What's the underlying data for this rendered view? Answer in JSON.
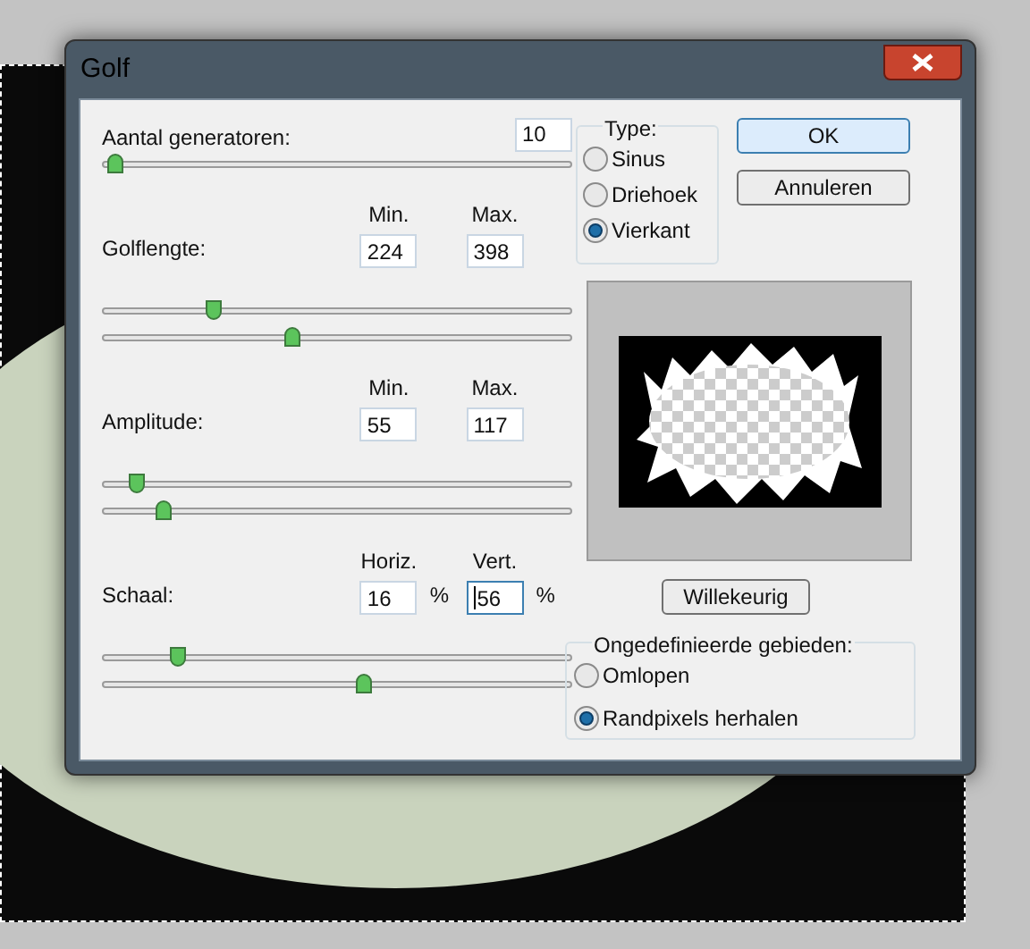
{
  "window": {
    "title": "Golf"
  },
  "generators": {
    "label": "Aantal generatoren:",
    "value": "10",
    "level": 0.01
  },
  "ranges": [
    {
      "label": "Golflengte:",
      "fields": [
        {
          "header": "Min.",
          "value": "224",
          "focused": false
        },
        {
          "header": "Max.",
          "value": "398",
          "focused": false
        }
      ],
      "sliders": [
        {
          "level": 0.23
        },
        {
          "level": 0.4
        }
      ]
    },
    {
      "label": "Amplitude:",
      "fields": [
        {
          "header": "Min.",
          "value": "55",
          "focused": false
        },
        {
          "header": "Max.",
          "value": "117",
          "focused": false
        }
      ],
      "sliders": [
        {
          "level": 0.06
        },
        {
          "level": 0.12
        }
      ]
    },
    {
      "label": "Schaal:",
      "fields": [
        {
          "header": "Horiz.",
          "value": "16",
          "suffix": "%",
          "focused": false
        },
        {
          "header": "Vert.",
          "value": "56",
          "suffix": "%",
          "focused": true
        }
      ],
      "sliders": [
        {
          "level": 0.15
        },
        {
          "level": 0.56
        }
      ]
    }
  ],
  "type_group": {
    "title": "Type:",
    "options": [
      {
        "label": "Sinus",
        "selected": false
      },
      {
        "label": "Driehoek",
        "selected": false
      },
      {
        "label": "Vierkant",
        "selected": true
      }
    ]
  },
  "buttons": [
    {
      "label": "OK",
      "default": true
    },
    {
      "label": "Annuleren",
      "default": false
    }
  ],
  "random_button": "Willekeurig",
  "undefined_areas": {
    "title": "Ongedefinieerde gebieden:",
    "options": [
      {
        "label": "Omlopen",
        "selected": false
      },
      {
        "label": "Randpixels herhalen",
        "selected": true
      }
    ]
  }
}
